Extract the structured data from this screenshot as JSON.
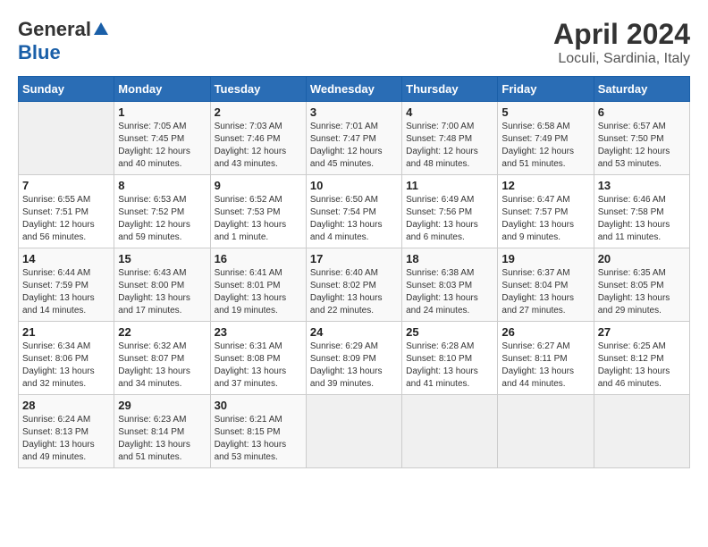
{
  "header": {
    "logo_general": "General",
    "logo_blue": "Blue",
    "month_year": "April 2024",
    "location": "Loculi, Sardinia, Italy"
  },
  "days_of_week": [
    "Sunday",
    "Monday",
    "Tuesday",
    "Wednesday",
    "Thursday",
    "Friday",
    "Saturday"
  ],
  "weeks": [
    [
      {
        "day": "",
        "detail": ""
      },
      {
        "day": "1",
        "detail": "Sunrise: 7:05 AM\nSunset: 7:45 PM\nDaylight: 12 hours\nand 40 minutes."
      },
      {
        "day": "2",
        "detail": "Sunrise: 7:03 AM\nSunset: 7:46 PM\nDaylight: 12 hours\nand 43 minutes."
      },
      {
        "day": "3",
        "detail": "Sunrise: 7:01 AM\nSunset: 7:47 PM\nDaylight: 12 hours\nand 45 minutes."
      },
      {
        "day": "4",
        "detail": "Sunrise: 7:00 AM\nSunset: 7:48 PM\nDaylight: 12 hours\nand 48 minutes."
      },
      {
        "day": "5",
        "detail": "Sunrise: 6:58 AM\nSunset: 7:49 PM\nDaylight: 12 hours\nand 51 minutes."
      },
      {
        "day": "6",
        "detail": "Sunrise: 6:57 AM\nSunset: 7:50 PM\nDaylight: 12 hours\nand 53 minutes."
      }
    ],
    [
      {
        "day": "7",
        "detail": "Sunrise: 6:55 AM\nSunset: 7:51 PM\nDaylight: 12 hours\nand 56 minutes."
      },
      {
        "day": "8",
        "detail": "Sunrise: 6:53 AM\nSunset: 7:52 PM\nDaylight: 12 hours\nand 59 minutes."
      },
      {
        "day": "9",
        "detail": "Sunrise: 6:52 AM\nSunset: 7:53 PM\nDaylight: 13 hours\nand 1 minute."
      },
      {
        "day": "10",
        "detail": "Sunrise: 6:50 AM\nSunset: 7:54 PM\nDaylight: 13 hours\nand 4 minutes."
      },
      {
        "day": "11",
        "detail": "Sunrise: 6:49 AM\nSunset: 7:56 PM\nDaylight: 13 hours\nand 6 minutes."
      },
      {
        "day": "12",
        "detail": "Sunrise: 6:47 AM\nSunset: 7:57 PM\nDaylight: 13 hours\nand 9 minutes."
      },
      {
        "day": "13",
        "detail": "Sunrise: 6:46 AM\nSunset: 7:58 PM\nDaylight: 13 hours\nand 11 minutes."
      }
    ],
    [
      {
        "day": "14",
        "detail": "Sunrise: 6:44 AM\nSunset: 7:59 PM\nDaylight: 13 hours\nand 14 minutes."
      },
      {
        "day": "15",
        "detail": "Sunrise: 6:43 AM\nSunset: 8:00 PM\nDaylight: 13 hours\nand 17 minutes."
      },
      {
        "day": "16",
        "detail": "Sunrise: 6:41 AM\nSunset: 8:01 PM\nDaylight: 13 hours\nand 19 minutes."
      },
      {
        "day": "17",
        "detail": "Sunrise: 6:40 AM\nSunset: 8:02 PM\nDaylight: 13 hours\nand 22 minutes."
      },
      {
        "day": "18",
        "detail": "Sunrise: 6:38 AM\nSunset: 8:03 PM\nDaylight: 13 hours\nand 24 minutes."
      },
      {
        "day": "19",
        "detail": "Sunrise: 6:37 AM\nSunset: 8:04 PM\nDaylight: 13 hours\nand 27 minutes."
      },
      {
        "day": "20",
        "detail": "Sunrise: 6:35 AM\nSunset: 8:05 PM\nDaylight: 13 hours\nand 29 minutes."
      }
    ],
    [
      {
        "day": "21",
        "detail": "Sunrise: 6:34 AM\nSunset: 8:06 PM\nDaylight: 13 hours\nand 32 minutes."
      },
      {
        "day": "22",
        "detail": "Sunrise: 6:32 AM\nSunset: 8:07 PM\nDaylight: 13 hours\nand 34 minutes."
      },
      {
        "day": "23",
        "detail": "Sunrise: 6:31 AM\nSunset: 8:08 PM\nDaylight: 13 hours\nand 37 minutes."
      },
      {
        "day": "24",
        "detail": "Sunrise: 6:29 AM\nSunset: 8:09 PM\nDaylight: 13 hours\nand 39 minutes."
      },
      {
        "day": "25",
        "detail": "Sunrise: 6:28 AM\nSunset: 8:10 PM\nDaylight: 13 hours\nand 41 minutes."
      },
      {
        "day": "26",
        "detail": "Sunrise: 6:27 AM\nSunset: 8:11 PM\nDaylight: 13 hours\nand 44 minutes."
      },
      {
        "day": "27",
        "detail": "Sunrise: 6:25 AM\nSunset: 8:12 PM\nDaylight: 13 hours\nand 46 minutes."
      }
    ],
    [
      {
        "day": "28",
        "detail": "Sunrise: 6:24 AM\nSunset: 8:13 PM\nDaylight: 13 hours\nand 49 minutes."
      },
      {
        "day": "29",
        "detail": "Sunrise: 6:23 AM\nSunset: 8:14 PM\nDaylight: 13 hours\nand 51 minutes."
      },
      {
        "day": "30",
        "detail": "Sunrise: 6:21 AM\nSunset: 8:15 PM\nDaylight: 13 hours\nand 53 minutes."
      },
      {
        "day": "",
        "detail": ""
      },
      {
        "day": "",
        "detail": ""
      },
      {
        "day": "",
        "detail": ""
      },
      {
        "day": "",
        "detail": ""
      }
    ]
  ]
}
